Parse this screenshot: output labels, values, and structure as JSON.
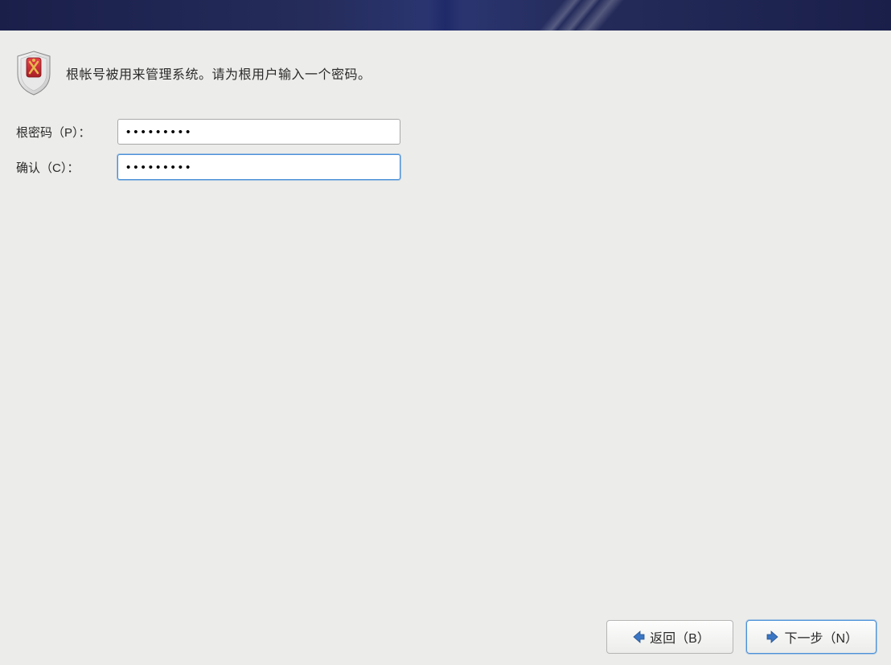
{
  "header": {
    "instruction": "根帐号被用来管理系统。请为根用户输入一个密码。"
  },
  "form": {
    "password_label": "根密码（P）：",
    "password_value": "•••••••••",
    "confirm_label": "确认（C）：",
    "confirm_value": "•••••••••"
  },
  "footer": {
    "back_label": "返回（B）",
    "next_label": "下一步（N）"
  },
  "icons": {
    "shield": "shield-icon",
    "arrow_back": "arrow-left-icon",
    "arrow_next": "arrow-right-icon"
  },
  "colors": {
    "banner": "#1a1f4a",
    "accent": "#4a90d9",
    "badge_red": "#c7282f",
    "badge_gold": "#e6b84c"
  }
}
